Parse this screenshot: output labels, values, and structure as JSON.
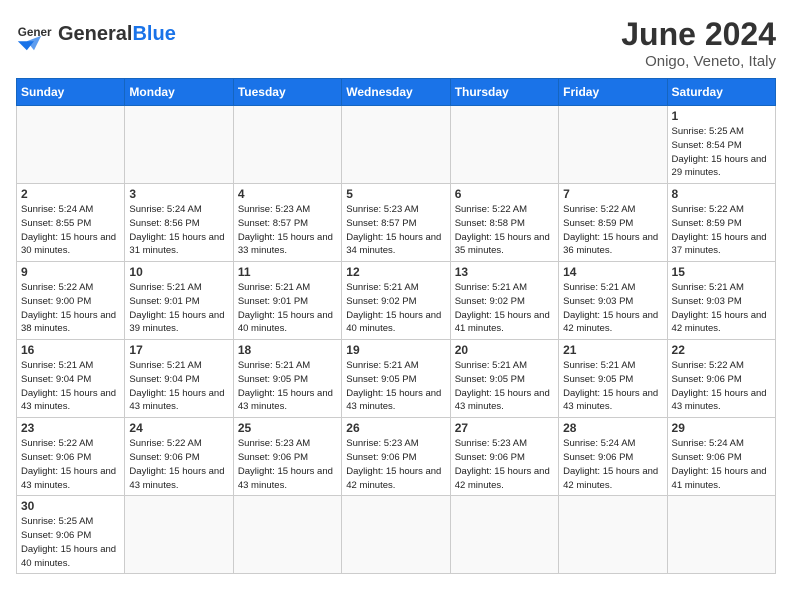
{
  "header": {
    "logo_general": "General",
    "logo_blue": "Blue",
    "month_title": "June 2024",
    "subtitle": "Onigo, Veneto, Italy"
  },
  "days_of_week": [
    "Sunday",
    "Monday",
    "Tuesday",
    "Wednesday",
    "Thursday",
    "Friday",
    "Saturday"
  ],
  "weeks": [
    [
      {
        "day": "",
        "info": ""
      },
      {
        "day": "",
        "info": ""
      },
      {
        "day": "",
        "info": ""
      },
      {
        "day": "",
        "info": ""
      },
      {
        "day": "",
        "info": ""
      },
      {
        "day": "",
        "info": ""
      },
      {
        "day": "1",
        "info": "Sunrise: 5:25 AM\nSunset: 8:54 PM\nDaylight: 15 hours\nand 29 minutes."
      }
    ],
    [
      {
        "day": "2",
        "info": "Sunrise: 5:24 AM\nSunset: 8:55 PM\nDaylight: 15 hours\nand 30 minutes."
      },
      {
        "day": "3",
        "info": "Sunrise: 5:24 AM\nSunset: 8:56 PM\nDaylight: 15 hours\nand 31 minutes."
      },
      {
        "day": "4",
        "info": "Sunrise: 5:23 AM\nSunset: 8:57 PM\nDaylight: 15 hours\nand 33 minutes."
      },
      {
        "day": "5",
        "info": "Sunrise: 5:23 AM\nSunset: 8:57 PM\nDaylight: 15 hours\nand 34 minutes."
      },
      {
        "day": "6",
        "info": "Sunrise: 5:22 AM\nSunset: 8:58 PM\nDaylight: 15 hours\nand 35 minutes."
      },
      {
        "day": "7",
        "info": "Sunrise: 5:22 AM\nSunset: 8:59 PM\nDaylight: 15 hours\nand 36 minutes."
      },
      {
        "day": "8",
        "info": "Sunrise: 5:22 AM\nSunset: 8:59 PM\nDaylight: 15 hours\nand 37 minutes."
      }
    ],
    [
      {
        "day": "9",
        "info": "Sunrise: 5:22 AM\nSunset: 9:00 PM\nDaylight: 15 hours\nand 38 minutes."
      },
      {
        "day": "10",
        "info": "Sunrise: 5:21 AM\nSunset: 9:01 PM\nDaylight: 15 hours\nand 39 minutes."
      },
      {
        "day": "11",
        "info": "Sunrise: 5:21 AM\nSunset: 9:01 PM\nDaylight: 15 hours\nand 40 minutes."
      },
      {
        "day": "12",
        "info": "Sunrise: 5:21 AM\nSunset: 9:02 PM\nDaylight: 15 hours\nand 40 minutes."
      },
      {
        "day": "13",
        "info": "Sunrise: 5:21 AM\nSunset: 9:02 PM\nDaylight: 15 hours\nand 41 minutes."
      },
      {
        "day": "14",
        "info": "Sunrise: 5:21 AM\nSunset: 9:03 PM\nDaylight: 15 hours\nand 42 minutes."
      },
      {
        "day": "15",
        "info": "Sunrise: 5:21 AM\nSunset: 9:03 PM\nDaylight: 15 hours\nand 42 minutes."
      }
    ],
    [
      {
        "day": "16",
        "info": "Sunrise: 5:21 AM\nSunset: 9:04 PM\nDaylight: 15 hours\nand 43 minutes."
      },
      {
        "day": "17",
        "info": "Sunrise: 5:21 AM\nSunset: 9:04 PM\nDaylight: 15 hours\nand 43 minutes."
      },
      {
        "day": "18",
        "info": "Sunrise: 5:21 AM\nSunset: 9:05 PM\nDaylight: 15 hours\nand 43 minutes."
      },
      {
        "day": "19",
        "info": "Sunrise: 5:21 AM\nSunset: 9:05 PM\nDaylight: 15 hours\nand 43 minutes."
      },
      {
        "day": "20",
        "info": "Sunrise: 5:21 AM\nSunset: 9:05 PM\nDaylight: 15 hours\nand 43 minutes."
      },
      {
        "day": "21",
        "info": "Sunrise: 5:21 AM\nSunset: 9:05 PM\nDaylight: 15 hours\nand 43 minutes."
      },
      {
        "day": "22",
        "info": "Sunrise: 5:22 AM\nSunset: 9:06 PM\nDaylight: 15 hours\nand 43 minutes."
      }
    ],
    [
      {
        "day": "23",
        "info": "Sunrise: 5:22 AM\nSunset: 9:06 PM\nDaylight: 15 hours\nand 43 minutes."
      },
      {
        "day": "24",
        "info": "Sunrise: 5:22 AM\nSunset: 9:06 PM\nDaylight: 15 hours\nand 43 minutes."
      },
      {
        "day": "25",
        "info": "Sunrise: 5:23 AM\nSunset: 9:06 PM\nDaylight: 15 hours\nand 43 minutes."
      },
      {
        "day": "26",
        "info": "Sunrise: 5:23 AM\nSunset: 9:06 PM\nDaylight: 15 hours\nand 42 minutes."
      },
      {
        "day": "27",
        "info": "Sunrise: 5:23 AM\nSunset: 9:06 PM\nDaylight: 15 hours\nand 42 minutes."
      },
      {
        "day": "28",
        "info": "Sunrise: 5:24 AM\nSunset: 9:06 PM\nDaylight: 15 hours\nand 42 minutes."
      },
      {
        "day": "29",
        "info": "Sunrise: 5:24 AM\nSunset: 9:06 PM\nDaylight: 15 hours\nand 41 minutes."
      }
    ],
    [
      {
        "day": "30",
        "info": "Sunrise: 5:25 AM\nSunset: 9:06 PM\nDaylight: 15 hours\nand 40 minutes."
      },
      {
        "day": "",
        "info": ""
      },
      {
        "day": "",
        "info": ""
      },
      {
        "day": "",
        "info": ""
      },
      {
        "day": "",
        "info": ""
      },
      {
        "day": "",
        "info": ""
      },
      {
        "day": "",
        "info": ""
      }
    ]
  ]
}
